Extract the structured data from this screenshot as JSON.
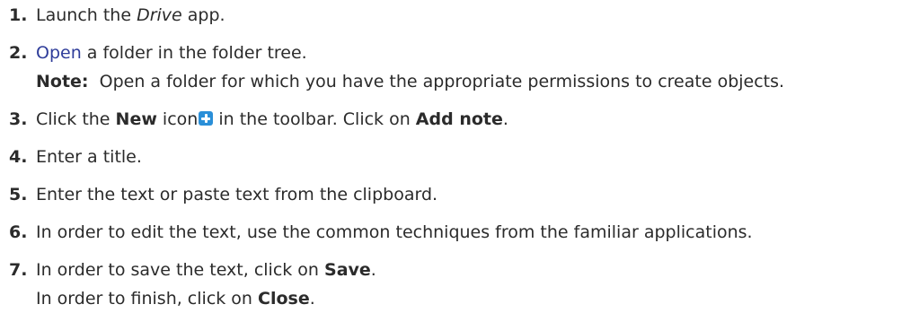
{
  "steps": [
    {
      "number": "1.",
      "text_before": "Launch the ",
      "app_name": "Drive",
      "text_after": " app."
    },
    {
      "number": "2.",
      "link_text": "Open",
      "text_after": " a folder in the folder tree.",
      "note_label": "Note:",
      "note_text": "  Open a folder for which you have the appropriate permissions to create objects."
    },
    {
      "number": "3.",
      "text_before": "Click the ",
      "new_label": "New",
      "icon_word": " icon",
      "icon_name": "new-icon",
      "text_middle": " in the toolbar. Click on ",
      "add_note_label": "Add note",
      "text_after": "."
    },
    {
      "number": "4.",
      "text": "Enter a title."
    },
    {
      "number": "5.",
      "text": "Enter the text or paste text from the clipboard."
    },
    {
      "number": "6.",
      "text": "In order to edit the text, use the common techniques from the familiar applications."
    },
    {
      "number": "7.",
      "text_before": "In order to save the text, click on ",
      "save_label": "Save",
      "text_after": ".",
      "sub_before": "In order to finish, click on ",
      "close_label": "Close",
      "sub_after": "."
    }
  ],
  "colors": {
    "text": "#2b2b2b",
    "link": "#2f3d9a",
    "icon": "#2a8fd8"
  }
}
